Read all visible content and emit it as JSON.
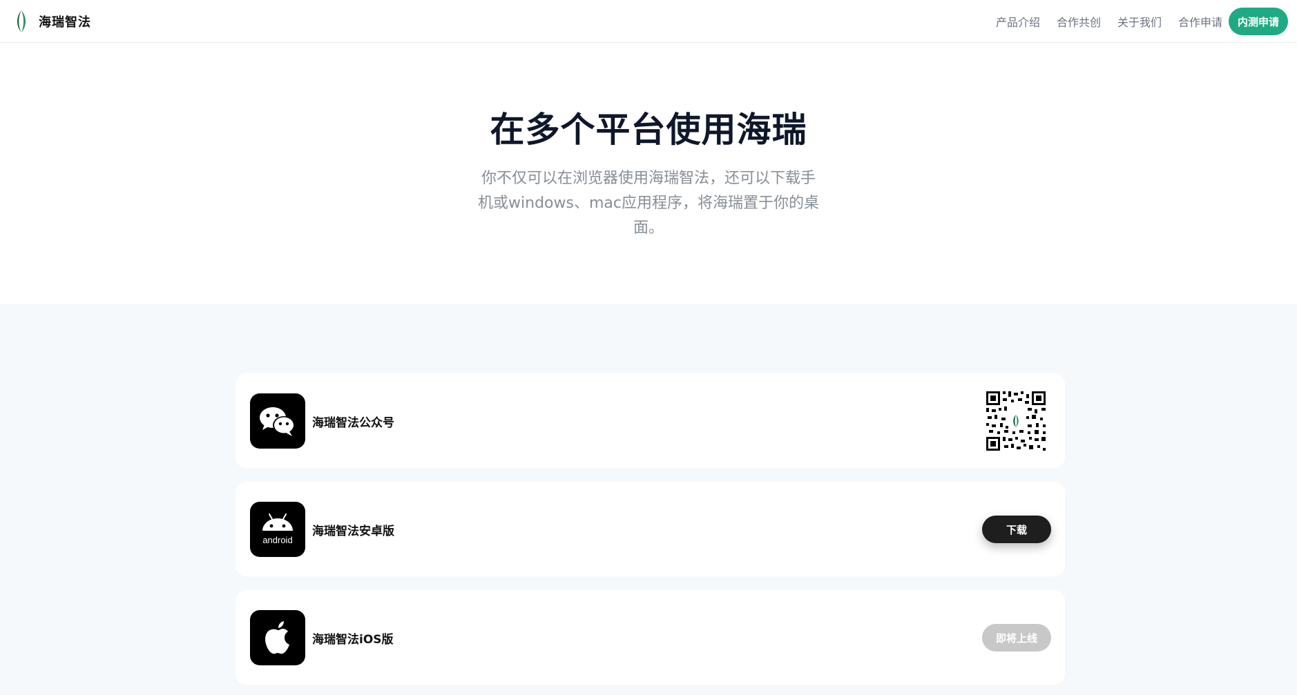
{
  "header": {
    "brand_name": "海瑞智法",
    "nav": [
      "产品介绍",
      "合作共创",
      "关于我们",
      "合作申请"
    ],
    "cta_label": "内测申请"
  },
  "hero": {
    "title": "在多个平台使用海瑞",
    "description": "你不仅可以在浏览器使用海瑞智法，还可以下载手机或windows、mac应用程序，将海瑞置于你的桌面。"
  },
  "platforms": [
    {
      "label": "海瑞智法公众号",
      "icon": "wechat-icon",
      "action": "qr-code"
    },
    {
      "label": "海瑞智法安卓版",
      "icon": "android-icon",
      "icon_text": "android",
      "action_label": "下载"
    },
    {
      "label": "海瑞智法iOS版",
      "icon": "apple-icon",
      "action_label": "即将上线"
    }
  ],
  "colors": {
    "accent": "#1faa83",
    "dark_button": "#1e1e1e",
    "disabled_button": "#c8c8c8",
    "section_background": "#f6f9fc",
    "title": "#0f172a",
    "muted_text": "#868e96"
  }
}
